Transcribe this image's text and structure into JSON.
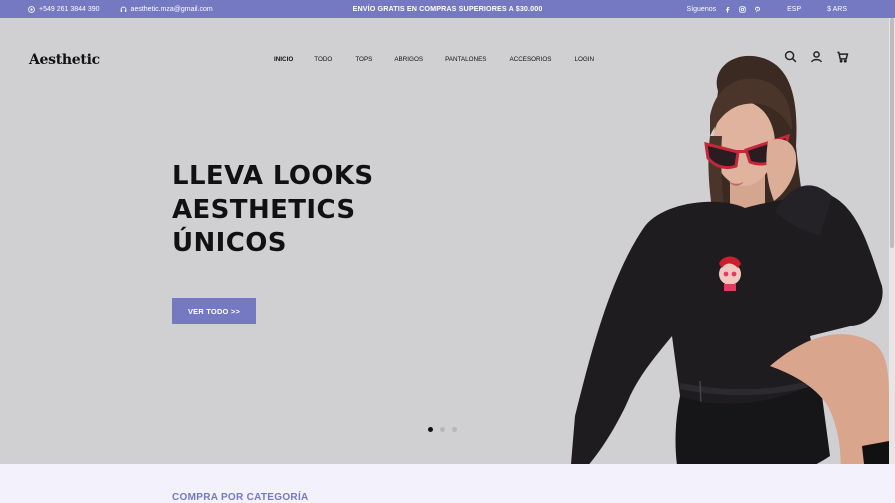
{
  "topbar": {
    "phone": "+549 261 3844 390",
    "email": "aesthetic.mza@gmail.com",
    "promo": "ENVÍO GRATIS EN COMPRAS SUPERIORES A $30.000",
    "follow": "Síguenos",
    "language": "ESP",
    "currency": "$ ARS"
  },
  "header": {
    "logo_prefix": "Ae",
    "logo_suffix": "sthetic",
    "nav": [
      "INICIO",
      "TODO",
      "TOPS",
      "ABRIGOS",
      "PANTALONES",
      "ACCESORIOS",
      "LOGIN"
    ]
  },
  "hero": {
    "line1": "LLEVA LOOKS",
    "line2": "AESTHETICS",
    "line3": "ÚNICOS",
    "cta": "VER TODO >>",
    "slides": 3,
    "active_slide": 1
  },
  "section": {
    "title": "COMPRA POR CATEGORÍA"
  },
  "colors": {
    "accent": "#7479c2",
    "hero_bg": "#d0d0d2",
    "page_bg": "#f3f1fb"
  }
}
